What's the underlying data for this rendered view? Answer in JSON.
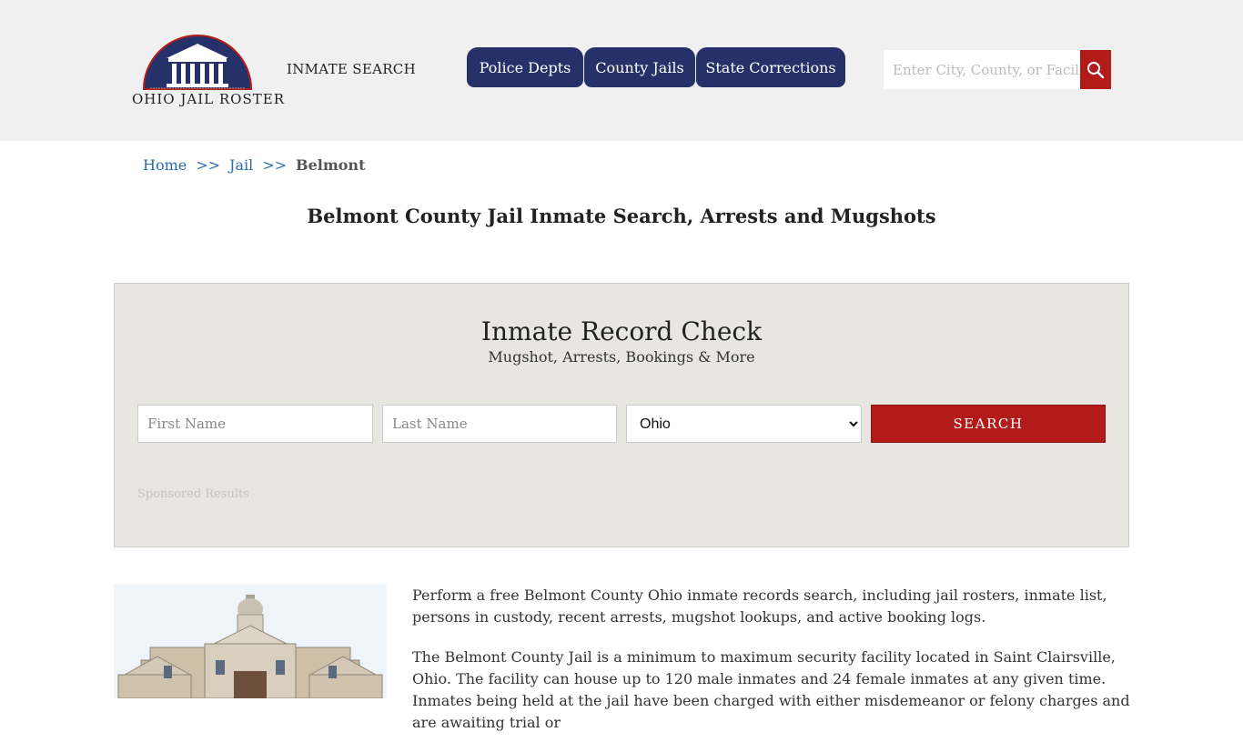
{
  "header": {
    "logo_text": "OHIO JAIL ROSTER",
    "inmate_search_link": "INMATE SEARCH",
    "nav": [
      "Police Depts",
      "County Jails",
      "State Corrections"
    ],
    "search_placeholder": "Enter City, County, or Facility"
  },
  "breadcrumb": {
    "home": "Home",
    "sep": ">>",
    "jail": "Jail",
    "current": "Belmont"
  },
  "page_title": "Belmont County Jail Inmate Search, Arrests and Mugshots",
  "record_check": {
    "title": "Inmate Record Check",
    "subtitle": "Mugshot, Arrests, Bookings & More",
    "first_name_placeholder": "First Name",
    "last_name_placeholder": "Last Name",
    "state_selected": "Ohio",
    "search_label": "SEARCH",
    "sponsored": "Sponsored Results"
  },
  "content": {
    "paragraph1": "Perform a free Belmont County Ohio inmate records search, including jail rosters, inmate list, persons in custody, recent arrests, mugshot lookups, and active booking logs.",
    "paragraph2": "The Belmont County Jail is a minimum to maximum security facility located in Saint Clairsville, Ohio. The facility can house up to 120 male inmates and 24 female inmates at any given time. Inmates being held at the jail have been charged with either misdemeanor or felony charges and are awaiting trial or"
  },
  "colors": {
    "nav_bg": "#26316a",
    "accent_red": "#b31b1b",
    "link_blue": "#2b6cb0"
  }
}
